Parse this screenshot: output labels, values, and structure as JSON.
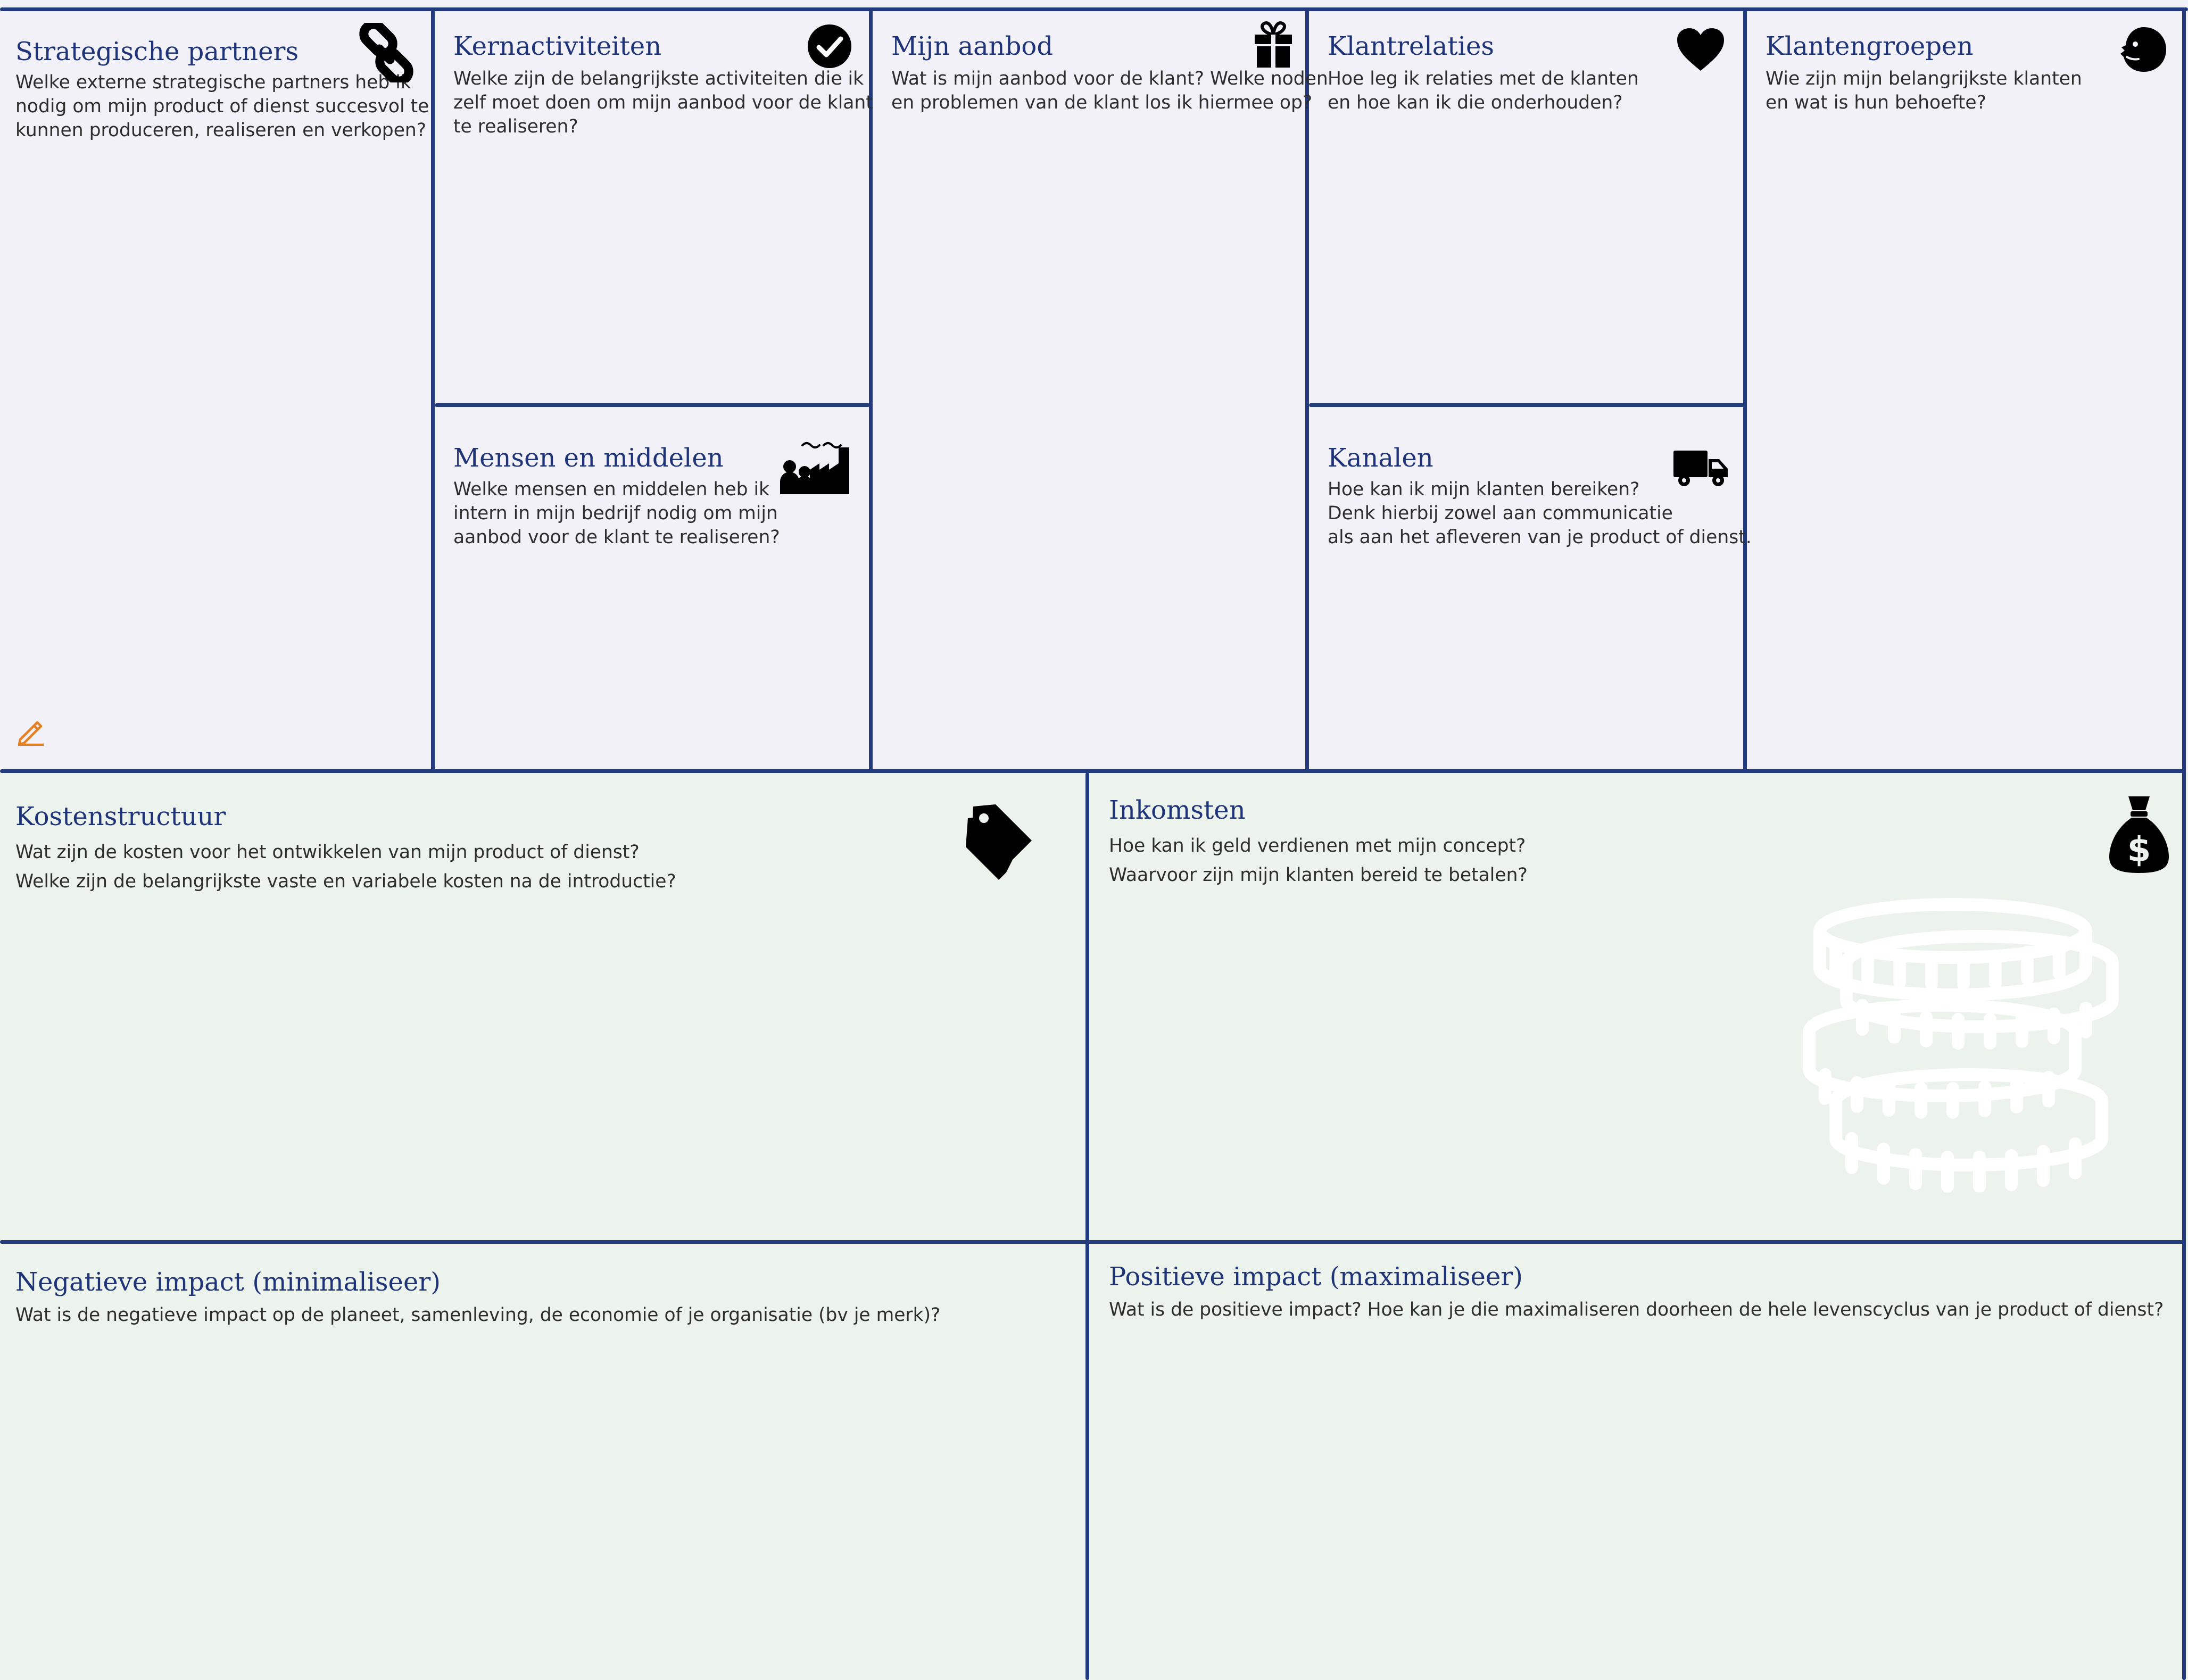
{
  "canvas": {
    "partners": {
      "title": "Strategische partners",
      "desc": [
        "Welke externe strategische partners heb ik",
        "nodig om mijn product of dienst succesvol te",
        "kunnen produceren, realiseren en verkopen?"
      ],
      "icon": "link-icon"
    },
    "activities": {
      "title": "Kernactiviteiten",
      "desc": [
        "Welke zijn de belangrijkste activiteiten die ik",
        "zelf moet doen om mijn aanbod voor de klant",
        "te realiseren?"
      ],
      "icon": "checkmark-circle-icon"
    },
    "resources": {
      "title": "Mensen en middelen",
      "desc": [
        "Welke mensen en middelen heb ik",
        "intern in mijn bedrijf nodig om mijn",
        "aanbod voor de klant te realiseren?"
      ],
      "icon": "people-factory-icon"
    },
    "offer": {
      "title": "Mijn aanbod",
      "desc": [
        "Wat is mijn aanbod voor de klant? Welke noden",
        "en problemen van de klant los ik hiermee op?"
      ],
      "icon": "gift-icon"
    },
    "relations": {
      "title": "Klantrelaties",
      "desc": [
        "Hoe leg ik relaties met de klanten",
        "en hoe kan ik die onderhouden?"
      ],
      "icon": "heart-icon"
    },
    "channels": {
      "title": "Kanalen",
      "desc": [
        "Hoe kan ik mijn klanten bereiken?",
        "Denk hierbij zowel aan communicatie",
        "als aan het afleveren van je product of dienst."
      ],
      "icon": "truck-icon"
    },
    "segments": {
      "title": "Klantengroepen",
      "desc": [
        "Wie zijn mijn belangrijkste klanten",
        "en wat is hun behoefte?"
      ],
      "icon": "face-icon"
    },
    "costs": {
      "title": "Kostenstructuur",
      "desc": [
        "Wat zijn de kosten voor het ontwikkelen van mijn product of dienst?",
        "Welke zijn de belangrijkste vaste en variabele kosten na de introductie?"
      ],
      "icon": "price-tags-icon"
    },
    "revenue": {
      "title": "Inkomsten",
      "desc": [
        "Hoe kan ik geld verdienen met mijn concept?",
        "Waarvoor zijn mijn klanten bereid te betalen?"
      ],
      "icon": "money-bag-icon"
    },
    "negative": {
      "title": "Negatieve impact (minimaliseer)",
      "desc": [
        "Wat is de negatieve impact op de planeet, samenleving, de economie of je organisatie (bv je merk)?"
      ]
    },
    "positive": {
      "title": "Positieve impact (maximaliseer)",
      "desc": [
        "Wat is de positieve impact? Hoe kan je die maximaliseren doorheen de hele levenscyclus van je product of dienst?"
      ]
    }
  },
  "colors": {
    "line": "#233a7c",
    "title": "#1f3478",
    "text": "#2d2d2d",
    "top_background": "#f2f1f7",
    "bottom_background": "#ebf3ec",
    "icon": "#000000",
    "pencil": "#e67e22",
    "coins": "#ffffff"
  }
}
